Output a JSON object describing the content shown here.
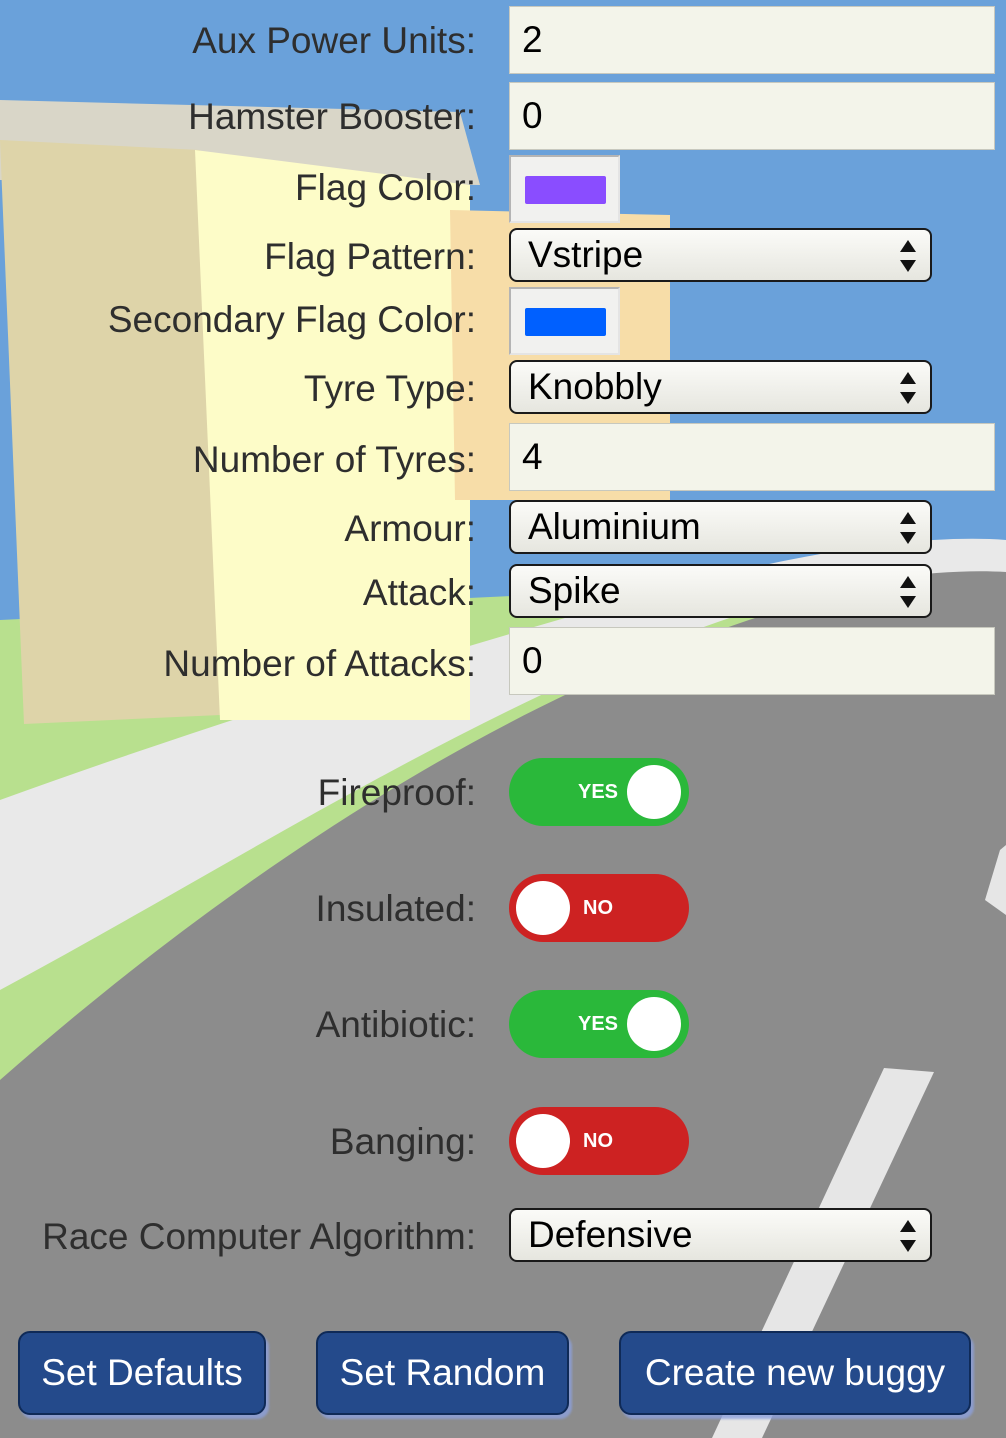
{
  "fields": {
    "aux_power_units": {
      "label": "Aux Power Units:",
      "value": "2"
    },
    "hamster_booster": {
      "label": "Hamster Booster:",
      "value": "0"
    },
    "flag_color": {
      "label": "Flag Color:",
      "value": "#8a4dff"
    },
    "flag_pattern": {
      "label": "Flag Pattern:",
      "value": "Vstripe"
    },
    "secondary_flag_color": {
      "label": "Secondary Flag Color:",
      "value": "#0060ff"
    },
    "tyre_type": {
      "label": "Tyre Type:",
      "value": "Knobbly"
    },
    "number_of_tyres": {
      "label": "Number of Tyres:",
      "value": "4"
    },
    "armour": {
      "label": "Armour:",
      "value": "Aluminium"
    },
    "attack": {
      "label": "Attack:",
      "value": "Spike"
    },
    "number_of_attacks": {
      "label": "Number of Attacks:",
      "value": "0"
    },
    "fireproof": {
      "label": "Fireproof:",
      "state": "YES"
    },
    "insulated": {
      "label": "Insulated:",
      "state": "NO"
    },
    "antibiotic": {
      "label": "Antibiotic:",
      "state": "YES"
    },
    "banging": {
      "label": "Banging:",
      "state": "NO"
    },
    "race_computer_algorithm": {
      "label": "Race Computer Algorithm:",
      "value": "Defensive"
    }
  },
  "buttons": {
    "set_defaults": "Set Defaults",
    "set_random": "Set Random",
    "create_new_buggy": "Create new buggy"
  },
  "colors": {
    "toggle_yes": "#2ab83a",
    "toggle_no": "#cd2222",
    "button": "#244a8b",
    "sky": "#6aa1da",
    "road": "#8c8c8c"
  }
}
